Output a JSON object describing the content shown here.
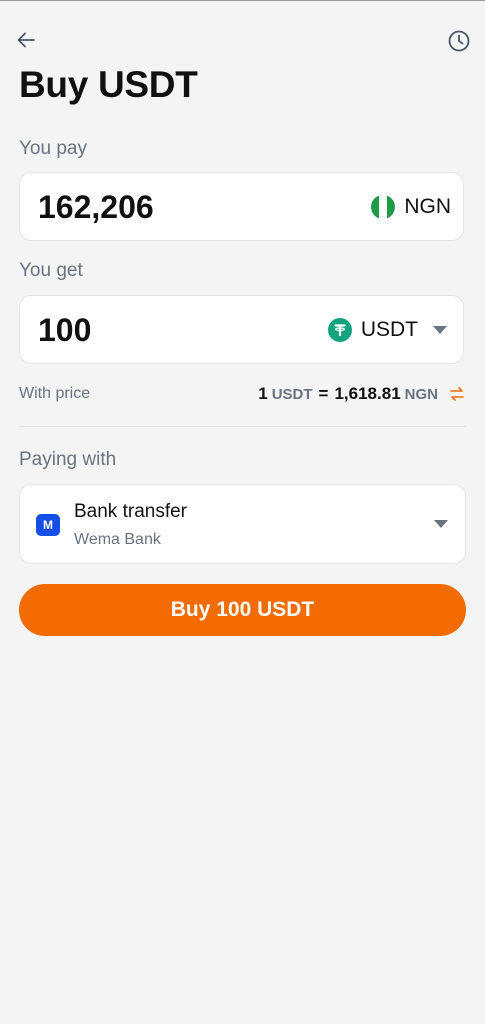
{
  "header": {
    "back_icon": "arrow-left-icon",
    "history_icon": "clock-icon",
    "title": "Buy USDT"
  },
  "pay": {
    "label": "You pay",
    "amount": "162,206",
    "currency": "NGN",
    "currency_icon": "nigeria-flag-icon"
  },
  "get": {
    "label": "You get",
    "amount": "100",
    "currency": "USDT",
    "currency_icon": "tether-icon"
  },
  "price": {
    "label": "With price",
    "base_amount": "1",
    "base_currency": "USDT",
    "equals": "=",
    "rate": "1,618.81",
    "quote_currency": "NGN",
    "swap_icon": "swap-icon"
  },
  "payment": {
    "label": "Paying with",
    "method": "Bank transfer",
    "bank": "Wema Bank",
    "bank_logo_letter": "M"
  },
  "action": {
    "buy_label": "Buy 100 USDT"
  },
  "colors": {
    "background": "#f4f4f5",
    "accent": "#f26b03",
    "tether": "#14a37f",
    "nigeria_green": "#1f9a49",
    "bank_blue": "#1450e8",
    "muted_text": "#6b7280"
  }
}
